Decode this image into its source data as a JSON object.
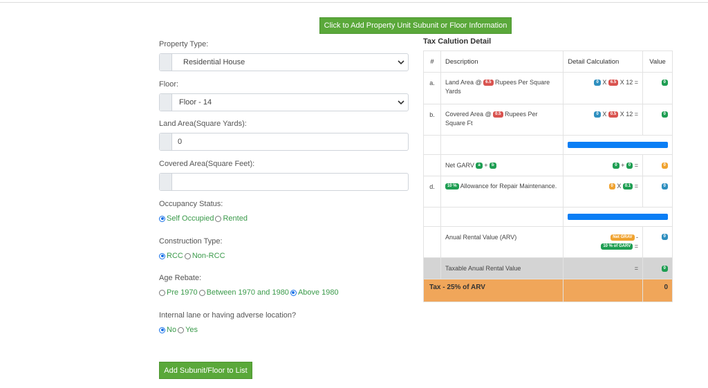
{
  "top_button": "Click to Add Property Unit Subunit or Floor Information",
  "form": {
    "property_type": {
      "label": "Property Type:",
      "value": "Residential House"
    },
    "floor": {
      "label": "Floor:",
      "value": "Floor - 14"
    },
    "land_area": {
      "label": "Land Area(Square Yards):",
      "value": "0"
    },
    "covered_area": {
      "label": "Covered Area(Square Feet):",
      "value": ""
    },
    "occupancy": {
      "label": "Occupancy Status:",
      "options": [
        "Self Occupied",
        "Rented"
      ],
      "selected": "Self Occupied"
    },
    "construction": {
      "label": "Construction Type:",
      "options": [
        "RCC",
        "Non-RCC"
      ],
      "selected": "RCC"
    },
    "age": {
      "label": "Age Rebate:",
      "options": [
        "Pre 1970",
        "Between 1970 and 1980",
        "Above 1980"
      ],
      "selected": "Above 1980"
    },
    "lane": {
      "label": "Internal lane or having adverse location?",
      "options": [
        "No",
        "Yes"
      ],
      "selected": "No"
    },
    "add_button": "Add Subunit/Floor to List"
  },
  "tax": {
    "title": "Tax Calution Detail",
    "headers": {
      "num": "#",
      "desc": "Description",
      "calc": "Detail Calculation",
      "value": "Value"
    },
    "row_a": {
      "num": "a.",
      "pre": "Land Area @",
      "rate": "6.5",
      "post": "Rupees Per Square Yards",
      "calc_a": "0",
      "x": "X",
      "calc_b": "6.5",
      "calc_c": "X 12 =",
      "value": "0"
    },
    "row_b": {
      "num": "b.",
      "pre": "Covered Area @",
      "rate": "0.5",
      "post": "Rupees Per Square Ft",
      "calc_a": "0",
      "x": "X",
      "calc_b": "0.5",
      "calc_c": "X 12 =",
      "value": "0"
    },
    "row_c": {
      "desc": "Net GARV",
      "ba": "a",
      "plus": "+",
      "bb": "b",
      "calc_a": "0",
      "calc_plus": "+",
      "calc_b": "0",
      "eq": "=",
      "value": "0"
    },
    "row_d": {
      "num": "d.",
      "pct": "10 %",
      "desc": "Allowance for Repair Maintenance.",
      "calc_a": "0",
      "x": "X",
      "calc_b": "0.1",
      "eq": "=",
      "value": "0"
    },
    "row_arv": {
      "desc": "Anual Rental Value (ARV)",
      "b1": "Net GRAV",
      "minus": "-",
      "b2": "10 % of GARV",
      "eq": "=",
      "value": "0"
    },
    "row_taxable": {
      "desc": "Taxable Anual Rental Value",
      "eq": "=",
      "value": "0"
    },
    "row_tax": {
      "desc": "Tax - 25% of ARV",
      "value": "0"
    }
  },
  "colors": {
    "green_button": "#5aa83a",
    "link_green": "#3a9a4a",
    "bar_blue": "#0b7ef5",
    "tax_orange": "#f0a65a"
  }
}
